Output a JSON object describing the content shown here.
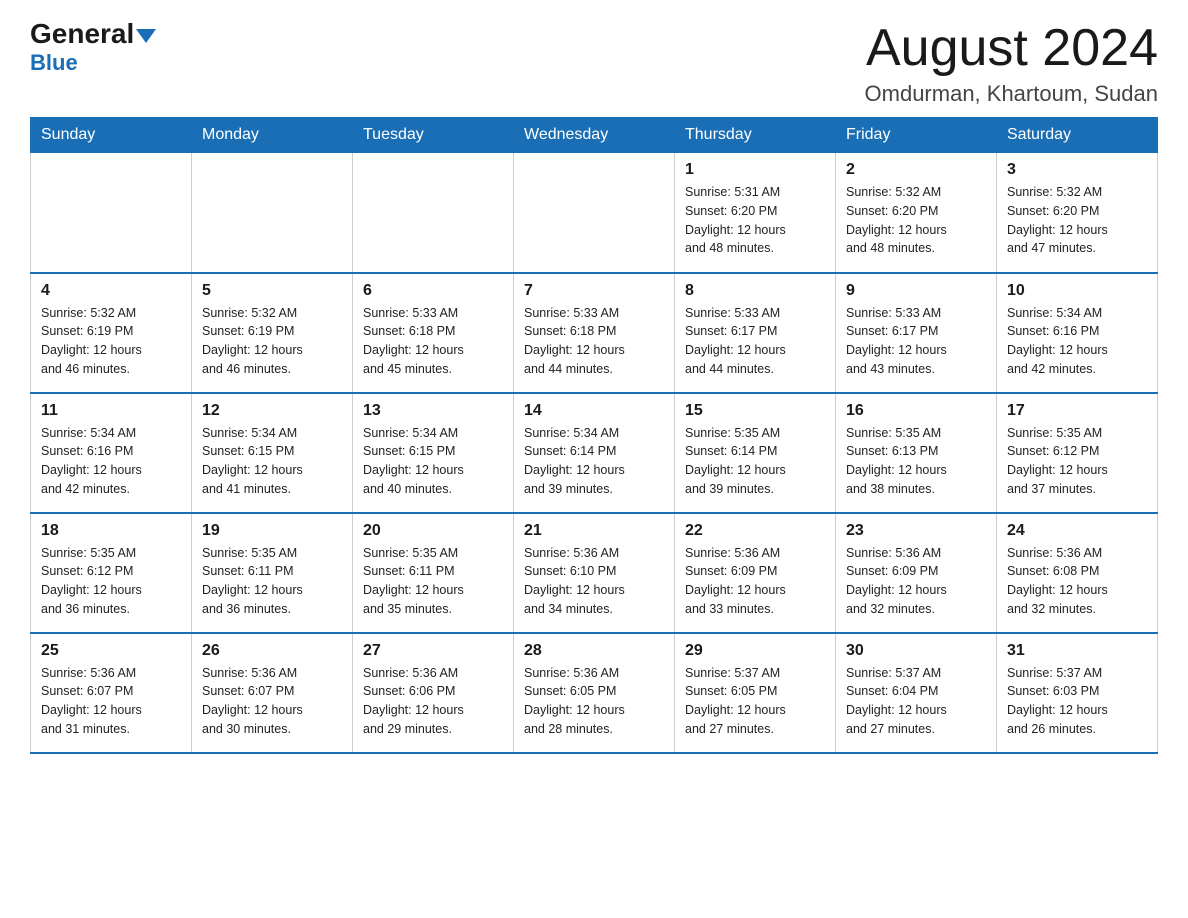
{
  "header": {
    "logo": {
      "general": "General",
      "blue": "Blue"
    },
    "title": "August 2024",
    "subtitle": "Omdurman, Khartoum, Sudan"
  },
  "days_of_week": [
    "Sunday",
    "Monday",
    "Tuesday",
    "Wednesday",
    "Thursday",
    "Friday",
    "Saturday"
  ],
  "weeks": [
    {
      "days": [
        {
          "number": "",
          "info": ""
        },
        {
          "number": "",
          "info": ""
        },
        {
          "number": "",
          "info": ""
        },
        {
          "number": "",
          "info": ""
        },
        {
          "number": "1",
          "info": "Sunrise: 5:31 AM\nSunset: 6:20 PM\nDaylight: 12 hours\nand 48 minutes."
        },
        {
          "number": "2",
          "info": "Sunrise: 5:32 AM\nSunset: 6:20 PM\nDaylight: 12 hours\nand 48 minutes."
        },
        {
          "number": "3",
          "info": "Sunrise: 5:32 AM\nSunset: 6:20 PM\nDaylight: 12 hours\nand 47 minutes."
        }
      ]
    },
    {
      "days": [
        {
          "number": "4",
          "info": "Sunrise: 5:32 AM\nSunset: 6:19 PM\nDaylight: 12 hours\nand 46 minutes."
        },
        {
          "number": "5",
          "info": "Sunrise: 5:32 AM\nSunset: 6:19 PM\nDaylight: 12 hours\nand 46 minutes."
        },
        {
          "number": "6",
          "info": "Sunrise: 5:33 AM\nSunset: 6:18 PM\nDaylight: 12 hours\nand 45 minutes."
        },
        {
          "number": "7",
          "info": "Sunrise: 5:33 AM\nSunset: 6:18 PM\nDaylight: 12 hours\nand 44 minutes."
        },
        {
          "number": "8",
          "info": "Sunrise: 5:33 AM\nSunset: 6:17 PM\nDaylight: 12 hours\nand 44 minutes."
        },
        {
          "number": "9",
          "info": "Sunrise: 5:33 AM\nSunset: 6:17 PM\nDaylight: 12 hours\nand 43 minutes."
        },
        {
          "number": "10",
          "info": "Sunrise: 5:34 AM\nSunset: 6:16 PM\nDaylight: 12 hours\nand 42 minutes."
        }
      ]
    },
    {
      "days": [
        {
          "number": "11",
          "info": "Sunrise: 5:34 AM\nSunset: 6:16 PM\nDaylight: 12 hours\nand 42 minutes."
        },
        {
          "number": "12",
          "info": "Sunrise: 5:34 AM\nSunset: 6:15 PM\nDaylight: 12 hours\nand 41 minutes."
        },
        {
          "number": "13",
          "info": "Sunrise: 5:34 AM\nSunset: 6:15 PM\nDaylight: 12 hours\nand 40 minutes."
        },
        {
          "number": "14",
          "info": "Sunrise: 5:34 AM\nSunset: 6:14 PM\nDaylight: 12 hours\nand 39 minutes."
        },
        {
          "number": "15",
          "info": "Sunrise: 5:35 AM\nSunset: 6:14 PM\nDaylight: 12 hours\nand 39 minutes."
        },
        {
          "number": "16",
          "info": "Sunrise: 5:35 AM\nSunset: 6:13 PM\nDaylight: 12 hours\nand 38 minutes."
        },
        {
          "number": "17",
          "info": "Sunrise: 5:35 AM\nSunset: 6:12 PM\nDaylight: 12 hours\nand 37 minutes."
        }
      ]
    },
    {
      "days": [
        {
          "number": "18",
          "info": "Sunrise: 5:35 AM\nSunset: 6:12 PM\nDaylight: 12 hours\nand 36 minutes."
        },
        {
          "number": "19",
          "info": "Sunrise: 5:35 AM\nSunset: 6:11 PM\nDaylight: 12 hours\nand 36 minutes."
        },
        {
          "number": "20",
          "info": "Sunrise: 5:35 AM\nSunset: 6:11 PM\nDaylight: 12 hours\nand 35 minutes."
        },
        {
          "number": "21",
          "info": "Sunrise: 5:36 AM\nSunset: 6:10 PM\nDaylight: 12 hours\nand 34 minutes."
        },
        {
          "number": "22",
          "info": "Sunrise: 5:36 AM\nSunset: 6:09 PM\nDaylight: 12 hours\nand 33 minutes."
        },
        {
          "number": "23",
          "info": "Sunrise: 5:36 AM\nSunset: 6:09 PM\nDaylight: 12 hours\nand 32 minutes."
        },
        {
          "number": "24",
          "info": "Sunrise: 5:36 AM\nSunset: 6:08 PM\nDaylight: 12 hours\nand 32 minutes."
        }
      ]
    },
    {
      "days": [
        {
          "number": "25",
          "info": "Sunrise: 5:36 AM\nSunset: 6:07 PM\nDaylight: 12 hours\nand 31 minutes."
        },
        {
          "number": "26",
          "info": "Sunrise: 5:36 AM\nSunset: 6:07 PM\nDaylight: 12 hours\nand 30 minutes."
        },
        {
          "number": "27",
          "info": "Sunrise: 5:36 AM\nSunset: 6:06 PM\nDaylight: 12 hours\nand 29 minutes."
        },
        {
          "number": "28",
          "info": "Sunrise: 5:36 AM\nSunset: 6:05 PM\nDaylight: 12 hours\nand 28 minutes."
        },
        {
          "number": "29",
          "info": "Sunrise: 5:37 AM\nSunset: 6:05 PM\nDaylight: 12 hours\nand 27 minutes."
        },
        {
          "number": "30",
          "info": "Sunrise: 5:37 AM\nSunset: 6:04 PM\nDaylight: 12 hours\nand 27 minutes."
        },
        {
          "number": "31",
          "info": "Sunrise: 5:37 AM\nSunset: 6:03 PM\nDaylight: 12 hours\nand 26 minutes."
        }
      ]
    }
  ]
}
